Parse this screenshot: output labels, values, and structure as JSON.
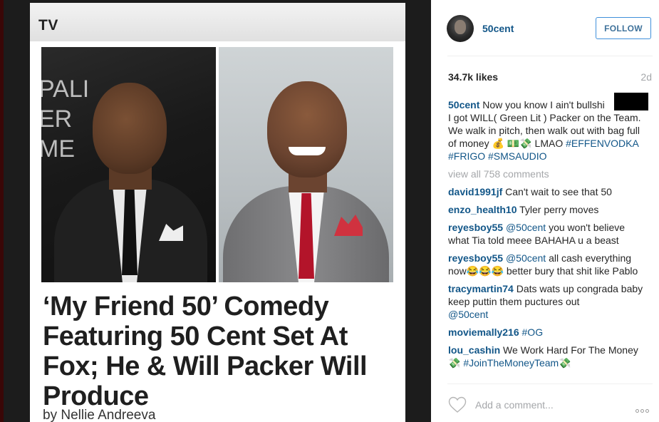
{
  "article": {
    "section_label": "TV",
    "headline": "‘My Friend 50’ Comedy Featuring 50 Cent Set At Fox; He & Will Packer Will Produce",
    "byline": "by Nellie Andreeva",
    "backdrop_letters": [
      "PALI",
      "ER",
      "ME"
    ]
  },
  "post": {
    "username": "50cent",
    "follow_label": "FOLLOW",
    "likes": "34.7k likes",
    "time": "2d",
    "caption": {
      "user": "50cent",
      "text": "Now you know I ain't bullshi",
      "text2": "I got WILL( Green Lit ) Packer on the Team. We walk in pitch, then walk out with bag full of money 💰 💵💸 LMAO",
      "tags": [
        "#EFFENVODKA",
        "#FRIGO",
        "#SMSAUDIO"
      ]
    },
    "view_all": "view all 758 comments",
    "comments": [
      {
        "user": "david1991jf",
        "text": "Can't wait to see that 50"
      },
      {
        "user": "enzo_health10",
        "text": "Tyler perry moves"
      },
      {
        "user": "reyesboy55",
        "mention": "@50cent",
        "text": "you won't believe what Tia told meee BAHAHA u a beast"
      },
      {
        "user": "reyesboy55",
        "mention": "@50cent",
        "text": "all cash everything now😂😂😂 better bury that shit like Pablo"
      },
      {
        "user": "tracymartin74",
        "text": "Dats wats up congrada baby keep puttin them puctures out",
        "mention_after": "@50cent"
      },
      {
        "user": "moviemally216",
        "tag": "#OG"
      },
      {
        "user": "lou_cashin",
        "text": "We Work Hard For The Money💸",
        "tag": "#JoinTheMoneyTeam💸"
      }
    ],
    "add_comment_placeholder": "Add a comment...",
    "icons": {
      "like": "heart-icon",
      "more": "more-options-icon"
    },
    "colors": {
      "link": "#125688",
      "follow": "#3f729b",
      "muted": "#a5a7aa"
    }
  }
}
